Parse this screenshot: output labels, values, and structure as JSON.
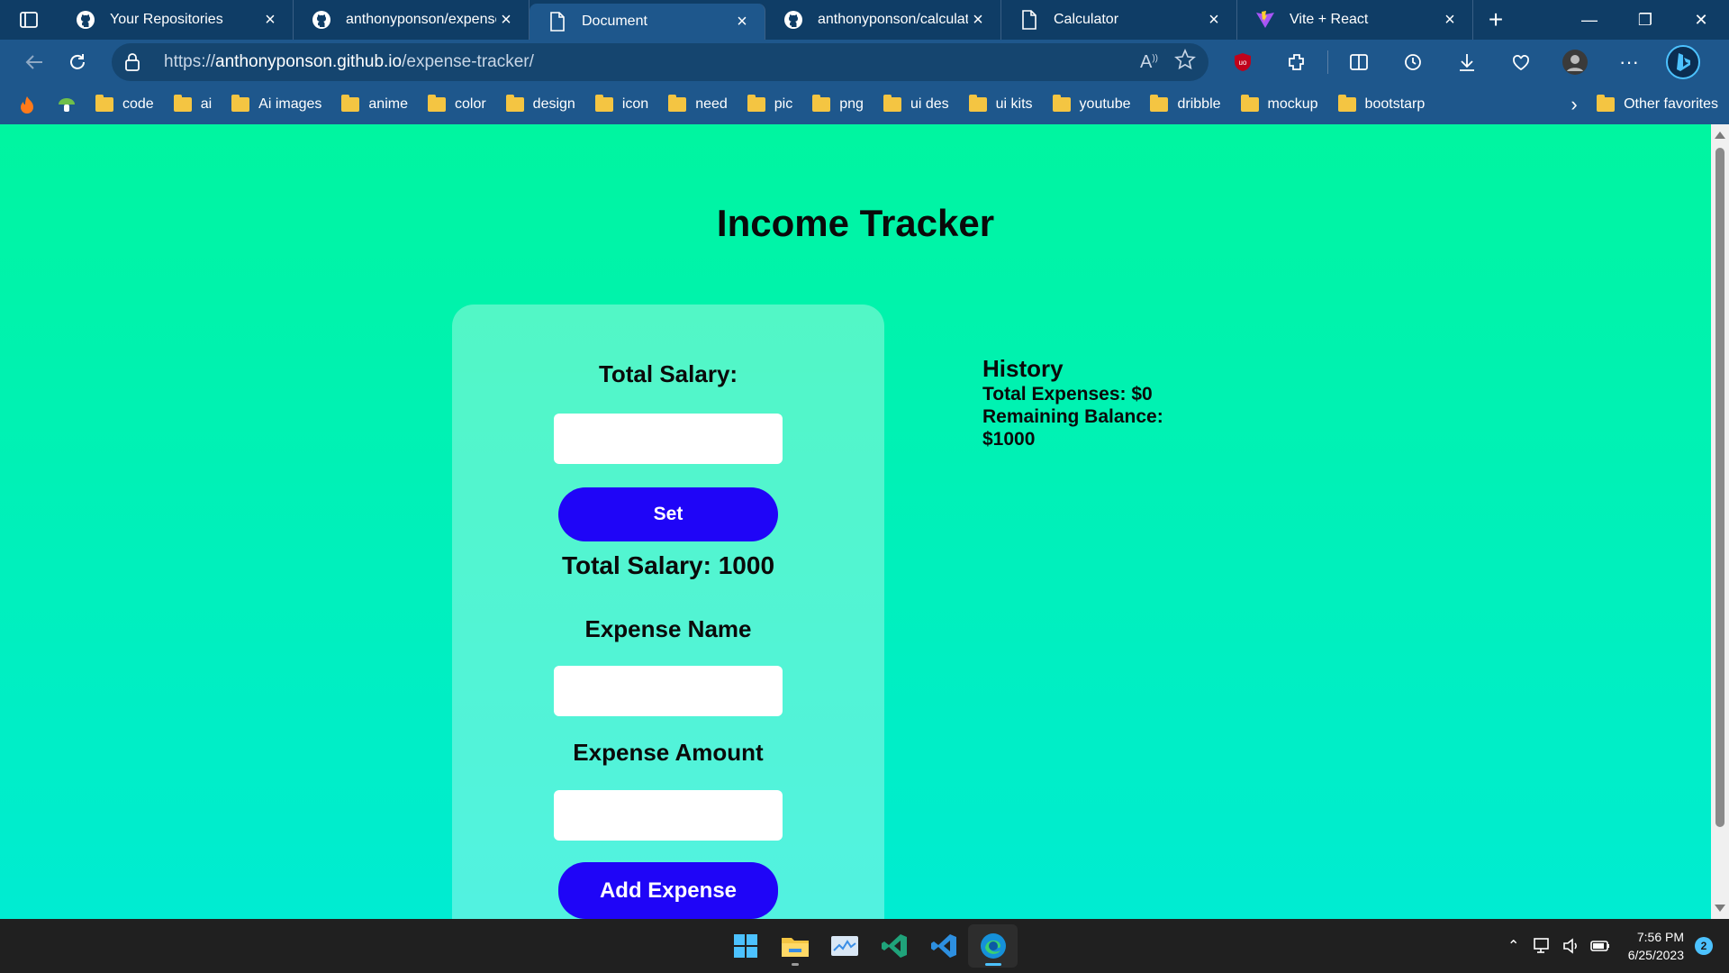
{
  "browser": {
    "tabs": [
      {
        "title": "Your Repositories",
        "icon": "github-icon",
        "active": false
      },
      {
        "title": "anthonyponson/expense",
        "icon": "github-icon",
        "active": false
      },
      {
        "title": "Document",
        "icon": "page-icon",
        "active": true
      },
      {
        "title": "anthonyponson/calculat",
        "icon": "github-icon",
        "active": false
      },
      {
        "title": "Calculator",
        "icon": "page-icon",
        "active": false
      },
      {
        "title": "Vite + React",
        "icon": "vite-icon",
        "active": false
      }
    ],
    "url_prefix": "https://",
    "url_host": "anthonyponson.github.io",
    "url_path": "/expense-tracker/",
    "bookmarks": [
      {
        "label": "code"
      },
      {
        "label": "ai"
      },
      {
        "label": "Ai images"
      },
      {
        "label": "anime"
      },
      {
        "label": "color"
      },
      {
        "label": "design"
      },
      {
        "label": "icon"
      },
      {
        "label": "need"
      },
      {
        "label": "pic"
      },
      {
        "label": "png"
      },
      {
        "label": "ui des"
      },
      {
        "label": "ui kits"
      },
      {
        "label": "youtube"
      },
      {
        "label": "dribble"
      },
      {
        "label": "mockup"
      },
      {
        "label": "bootstarp"
      }
    ],
    "other_favorites": "Other favorites",
    "colors": {
      "titlebar": "#0f3d66",
      "toolbar": "#1e578c",
      "folder": "#f4c542"
    }
  },
  "page": {
    "title": "Income Tracker",
    "salary_label": "Total Salary:",
    "salary_input_value": "",
    "set_button": "Set",
    "total_salary_display": "Total Salary: 1000",
    "expense_name_label": "Expense Name",
    "expense_name_value": "",
    "expense_amount_label": "Expense Amount",
    "expense_amount_value": "",
    "add_button": "Add Expense",
    "history": {
      "title": "History",
      "total_expenses": "Total Expenses: $0",
      "remaining_label": "Remaining Balance:",
      "remaining_value": "$1000"
    },
    "colors": {
      "button": "#1f05f7",
      "bg_top": "#00f5a0",
      "bg_bottom": "#00ecd2"
    }
  },
  "taskbar": {
    "apps": [
      "windows-start-icon",
      "file-explorer-icon",
      "task-manager-icon",
      "visual-studio-icon",
      "vscode-icon",
      "edge-icon"
    ],
    "time": "7:56 PM",
    "date": "6/25/2023",
    "notification_count": "2"
  }
}
